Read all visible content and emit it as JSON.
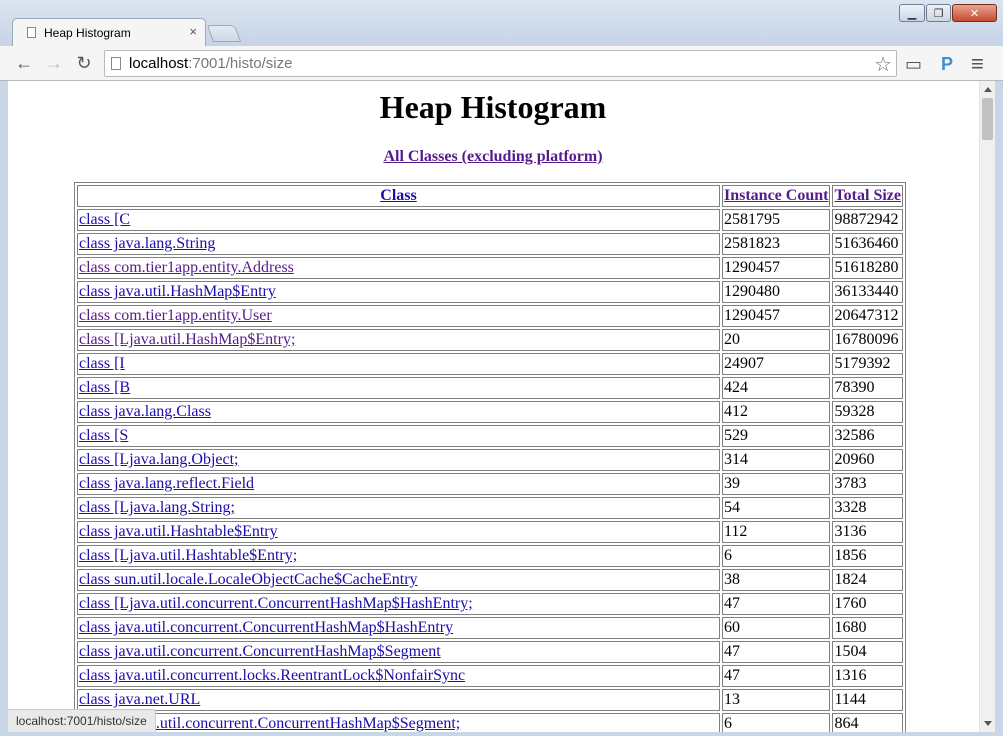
{
  "window": {
    "minimize_glyph": "▁",
    "restore_glyph": "❐",
    "close_glyph": "✕"
  },
  "tab": {
    "title": "Heap Histogram",
    "close_glyph": "×"
  },
  "toolbar": {
    "back_glyph": "←",
    "forward_glyph": "→",
    "reload_glyph": "↻",
    "url_host": "localhost",
    "url_rest": ":7001/histo/size",
    "star_glyph": "☆",
    "cast_glyph": "▭",
    "extension_label": "P",
    "menu_glyph": "≡"
  },
  "page": {
    "title": "Heap Histogram",
    "all_classes_link": "All Classes (excluding platform)",
    "table": {
      "headers": [
        "Class",
        "Instance Count",
        "Total Size"
      ],
      "rows": [
        {
          "cls": "class [C",
          "count": "2581795",
          "size": "98872942",
          "visited": false
        },
        {
          "cls": "class java.lang.String",
          "count": "2581823",
          "size": "51636460",
          "visited": false
        },
        {
          "cls": "class com.tier1app.entity.Address",
          "count": "1290457",
          "size": "51618280",
          "visited": true
        },
        {
          "cls": "class java.util.HashMap$Entry",
          "count": "1290480",
          "size": "36133440",
          "visited": false
        },
        {
          "cls": "class com.tier1app.entity.User",
          "count": "1290457",
          "size": "20647312",
          "visited": true
        },
        {
          "cls": "class [Ljava.util.HashMap$Entry;",
          "count": "20",
          "size": "16780096",
          "visited": true
        },
        {
          "cls": "class [I",
          "count": "24907",
          "size": "5179392",
          "visited": false
        },
        {
          "cls": "class [B",
          "count": "424",
          "size": "78390",
          "visited": false
        },
        {
          "cls": "class java.lang.Class",
          "count": "412",
          "size": "59328",
          "visited": false
        },
        {
          "cls": "class [S",
          "count": "529",
          "size": "32586",
          "visited": false
        },
        {
          "cls": "class [Ljava.lang.Object;",
          "count": "314",
          "size": "20960",
          "visited": false
        },
        {
          "cls": "class java.lang.reflect.Field",
          "count": "39",
          "size": "3783",
          "visited": false
        },
        {
          "cls": "class [Ljava.lang.String;",
          "count": "54",
          "size": "3328",
          "visited": false
        },
        {
          "cls": "class java.util.Hashtable$Entry",
          "count": "112",
          "size": "3136",
          "visited": false
        },
        {
          "cls": "class [Ljava.util.Hashtable$Entry;",
          "count": "6",
          "size": "1856",
          "visited": false
        },
        {
          "cls": "class sun.util.locale.LocaleObjectCache$CacheEntry",
          "count": "38",
          "size": "1824",
          "visited": false
        },
        {
          "cls": "class [Ljava.util.concurrent.ConcurrentHashMap$HashEntry;",
          "count": "47",
          "size": "1760",
          "visited": false
        },
        {
          "cls": "class java.util.concurrent.ConcurrentHashMap$HashEntry",
          "count": "60",
          "size": "1680",
          "visited": false
        },
        {
          "cls": "class java.util.concurrent.ConcurrentHashMap$Segment",
          "count": "47",
          "size": "1504",
          "visited": false
        },
        {
          "cls": "class java.util.concurrent.locks.ReentrantLock$NonfairSync",
          "count": "47",
          "size": "1316",
          "visited": false
        },
        {
          "cls": "class java.net.URL",
          "count": "13",
          "size": "1144",
          "visited": false
        },
        {
          "cls": "class [Ljava.util.concurrent.ConcurrentHashMap$Segment;",
          "count": "6",
          "size": "864",
          "visited": false
        }
      ]
    }
  },
  "statusbar": {
    "text": "localhost:7001/histo/size"
  }
}
